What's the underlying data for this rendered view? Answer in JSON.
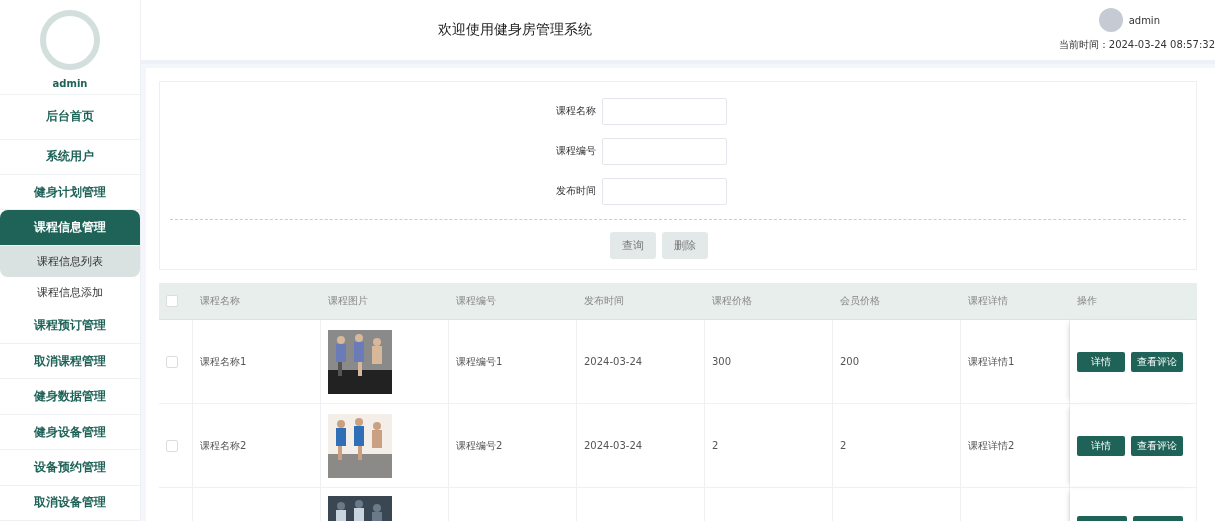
{
  "sidebar": {
    "user": "admin",
    "items": [
      {
        "label": "后台首页",
        "selected": false
      },
      {
        "label": "系统用户",
        "selected": false
      },
      {
        "label": "健身计划管理",
        "selected": false
      },
      {
        "label": "课程信息管理",
        "selected": true,
        "children": [
          {
            "label": "课程信息列表",
            "selected": true
          },
          {
            "label": "课程信息添加",
            "selected": false
          }
        ]
      },
      {
        "label": "课程预订管理",
        "selected": false
      },
      {
        "label": "取消课程管理",
        "selected": false
      },
      {
        "label": "健身数据管理",
        "selected": false
      },
      {
        "label": "健身设备管理",
        "selected": false
      },
      {
        "label": "设备预约管理",
        "selected": false
      },
      {
        "label": "取消设备管理",
        "selected": false
      }
    ]
  },
  "header": {
    "title": "欢迎使用健身房管理系统",
    "user": "admin",
    "time_label": "当前时间：",
    "time": "2024-03-24 08:57:32"
  },
  "search": {
    "fields": [
      {
        "label": "课程名称"
      },
      {
        "label": "课程编号"
      },
      {
        "label": "发布时间"
      }
    ],
    "buttons": [
      "查询",
      "删除"
    ]
  },
  "table": {
    "columns": [
      "课程名称",
      "课程图片",
      "课程编号",
      "发布时间",
      "课程价格",
      "会员价格",
      "课程详情",
      "操作"
    ],
    "header_checked": false,
    "rows": [
      {
        "kind": "full",
        "checked": false,
        "cells": [
          "课程名称1",
          {
            "kind": "picture"
          },
          "课程编号1",
          "2024-03-24",
          "300",
          "200",
          "课程详情1"
        ],
        "actions": [
          "详情",
          "查看评论"
        ]
      },
      {
        "kind": "full",
        "checked": false,
        "cells": [
          "课程名称2",
          {
            "kind": "picture"
          },
          "课程编号2",
          "2024-03-24",
          "2",
          "2",
          "课程详情2"
        ],
        "actions": [
          "详情",
          "查看评论"
        ]
      },
      {
        "kind": "partial",
        "cells": [
          {
            "kind": "picture"
          }
        ]
      }
    ]
  }
}
